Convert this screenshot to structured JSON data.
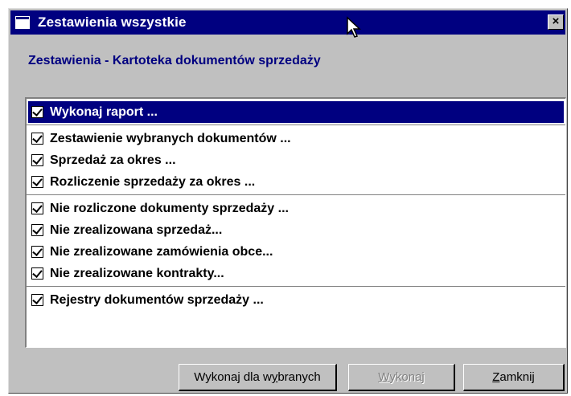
{
  "window": {
    "title": "Zestawienia wszystkie",
    "close_glyph": "×"
  },
  "subtitle": "Zestawienia - Kartoteka dokumentów sprzedaży",
  "groups": [
    {
      "items": [
        {
          "label": "Wykonaj raport ...",
          "checked": true,
          "selected": true
        }
      ]
    },
    {
      "items": [
        {
          "label": "Zestawienie wybranych dokumentów ...",
          "checked": true
        },
        {
          "label": "Sprzedaż za okres ...",
          "checked": true
        },
        {
          "label": "Rozliczenie sprzedaży za okres ...",
          "checked": true
        }
      ]
    },
    {
      "items": [
        {
          "label": "Nie rozliczone dokumenty sprzedaży ...",
          "checked": true
        },
        {
          "label": "Nie zrealizowana sprzedaż...",
          "checked": true
        },
        {
          "label": "Nie zrealizowane zamówienia obce...",
          "checked": true
        },
        {
          "label": "Nie zrealizowane kontrakty...",
          "checked": true
        }
      ]
    },
    {
      "items": [
        {
          "label": "Rejestry dokumentów sprzedaży ...",
          "checked": true
        }
      ]
    }
  ],
  "buttons": {
    "run_selected": {
      "before": "Wykonaj dla w",
      "accel": "y",
      "after": "branych"
    },
    "run": {
      "before": "",
      "accel": "W",
      "after": "ykonaj",
      "disabled": true
    },
    "close": {
      "before": "",
      "accel": "Z",
      "after": "amknij"
    }
  },
  "colors": {
    "titlebar": "#000080",
    "face": "#c0c0c0",
    "selection": "#000080"
  }
}
